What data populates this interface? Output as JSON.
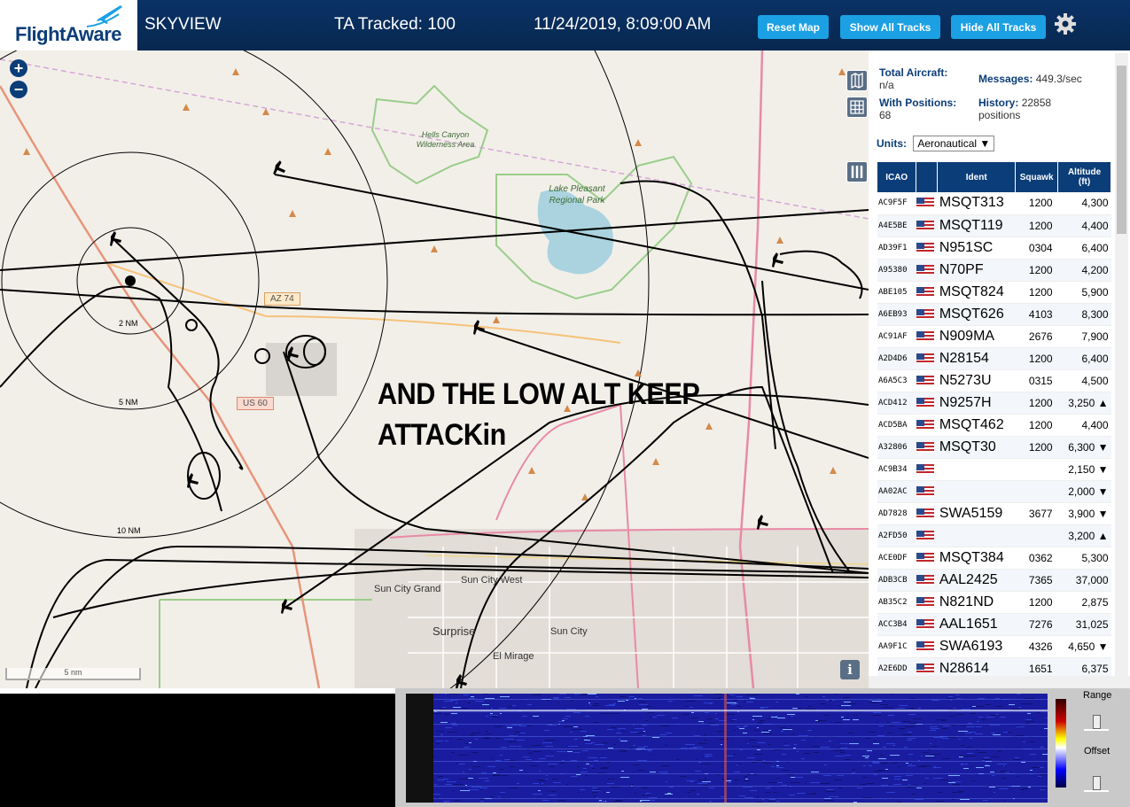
{
  "header": {
    "logo": "FlightAware",
    "app_title": "SKYVIEW",
    "ta_tracked": "TA Tracked: 100",
    "datetime": "11/24/2019, 8:09:00 AM",
    "buttons": {
      "reset_map": "Reset Map",
      "show_all": "Show All Tracks",
      "hide_all": "Hide All Tracks"
    },
    "settings_icon": "gear-icon"
  },
  "map": {
    "overlay_text_line1": "AND THE LOW ALT KEEP",
    "overlay_text_line2": "ATTACKin",
    "zoom_in": "+",
    "zoom_out": "−",
    "scale_label": "5 nm",
    "range_rings": [
      "2 NM",
      "5 NM",
      "10 NM"
    ],
    "place_labels": [
      "Hells Canyon Wilderness Area",
      "Lake Pleasant Regional Park",
      "Sun City Grand",
      "Sun City West",
      "Surprise",
      "Sun City",
      "El Mirage"
    ],
    "road_labels": [
      "AZ 74",
      "US 60"
    ],
    "info": "i"
  },
  "sidebar": {
    "stats": {
      "total_aircraft_label": "Total Aircraft:",
      "total_aircraft": "n/a",
      "messages_label": "Messages:",
      "messages": "449.3/sec",
      "with_positions_label": "With Positions:",
      "with_positions": "68",
      "history_label": "History:",
      "history": "22858",
      "history_unit": "positions"
    },
    "units_label": "Units:",
    "units_value": "Aeronautical",
    "table": {
      "headers": [
        "ICAO",
        "",
        "Ident",
        "Squawk",
        "Altitude (ft)"
      ],
      "rows": [
        {
          "icao": "AC9F5F",
          "ident": "MSQT313",
          "squawk": "1200",
          "alt": "4,300"
        },
        {
          "icao": "A4E5BE",
          "ident": "MSQT119",
          "squawk": "1200",
          "alt": "4,400"
        },
        {
          "icao": "AD39F1",
          "ident": "N951SC",
          "squawk": "0304",
          "alt": "6,400"
        },
        {
          "icao": "A95380",
          "ident": "N70PF",
          "squawk": "1200",
          "alt": "4,200"
        },
        {
          "icao": "ABE105",
          "ident": "MSQT824",
          "squawk": "1200",
          "alt": "5,900"
        },
        {
          "icao": "A6EB93",
          "ident": "MSQT626",
          "squawk": "4103",
          "alt": "8,300"
        },
        {
          "icao": "AC91AF",
          "ident": "N909MA",
          "squawk": "2676",
          "alt": "7,900"
        },
        {
          "icao": "A2D4D6",
          "ident": "N28154",
          "squawk": "1200",
          "alt": "6,400"
        },
        {
          "icao": "A6A5C3",
          "ident": "N5273U",
          "squawk": "0315",
          "alt": "4,500"
        },
        {
          "icao": "ACD412",
          "ident": "N9257H",
          "squawk": "1200",
          "alt": "3,250 ▲"
        },
        {
          "icao": "ACD5BA",
          "ident": "MSQT462",
          "squawk": "1200",
          "alt": "4,400"
        },
        {
          "icao": "A32806",
          "ident": "MSQT30",
          "squawk": "1200",
          "alt": "6,300 ▼"
        },
        {
          "icao": "AC9B34",
          "ident": "",
          "squawk": "",
          "alt": "2,150 ▼"
        },
        {
          "icao": "AA02AC",
          "ident": "",
          "squawk": "",
          "alt": "2,000 ▼"
        },
        {
          "icao": "AD7828",
          "ident": "SWA5159",
          "squawk": "3677",
          "alt": "3,900 ▼"
        },
        {
          "icao": "A2FD50",
          "ident": "",
          "squawk": "",
          "alt": "3,200 ▲"
        },
        {
          "icao": "ACE0DF",
          "ident": "MSQT384",
          "squawk": "0362",
          "alt": "5,300"
        },
        {
          "icao": "ADB3CB",
          "ident": "AAL2425",
          "squawk": "7365",
          "alt": "37,000"
        },
        {
          "icao": "AB35C2",
          "ident": "N821ND",
          "squawk": "1200",
          "alt": "2,875"
        },
        {
          "icao": "ACC3B4",
          "ident": "AAL1651",
          "squawk": "7276",
          "alt": "31,025"
        },
        {
          "icao": "AA9F1C",
          "ident": "SWA6193",
          "squawk": "4326",
          "alt": "4,650 ▼"
        },
        {
          "icao": "A2E6DD",
          "ident": "N28614",
          "squawk": "1651",
          "alt": "6,375"
        }
      ]
    }
  },
  "spectrum": {
    "range_label": "Range",
    "offset_label": "Offset"
  },
  "colors": {
    "header_bg": "#0b3267",
    "button": "#1ba0e3",
    "table_header": "#0b3d78"
  }
}
